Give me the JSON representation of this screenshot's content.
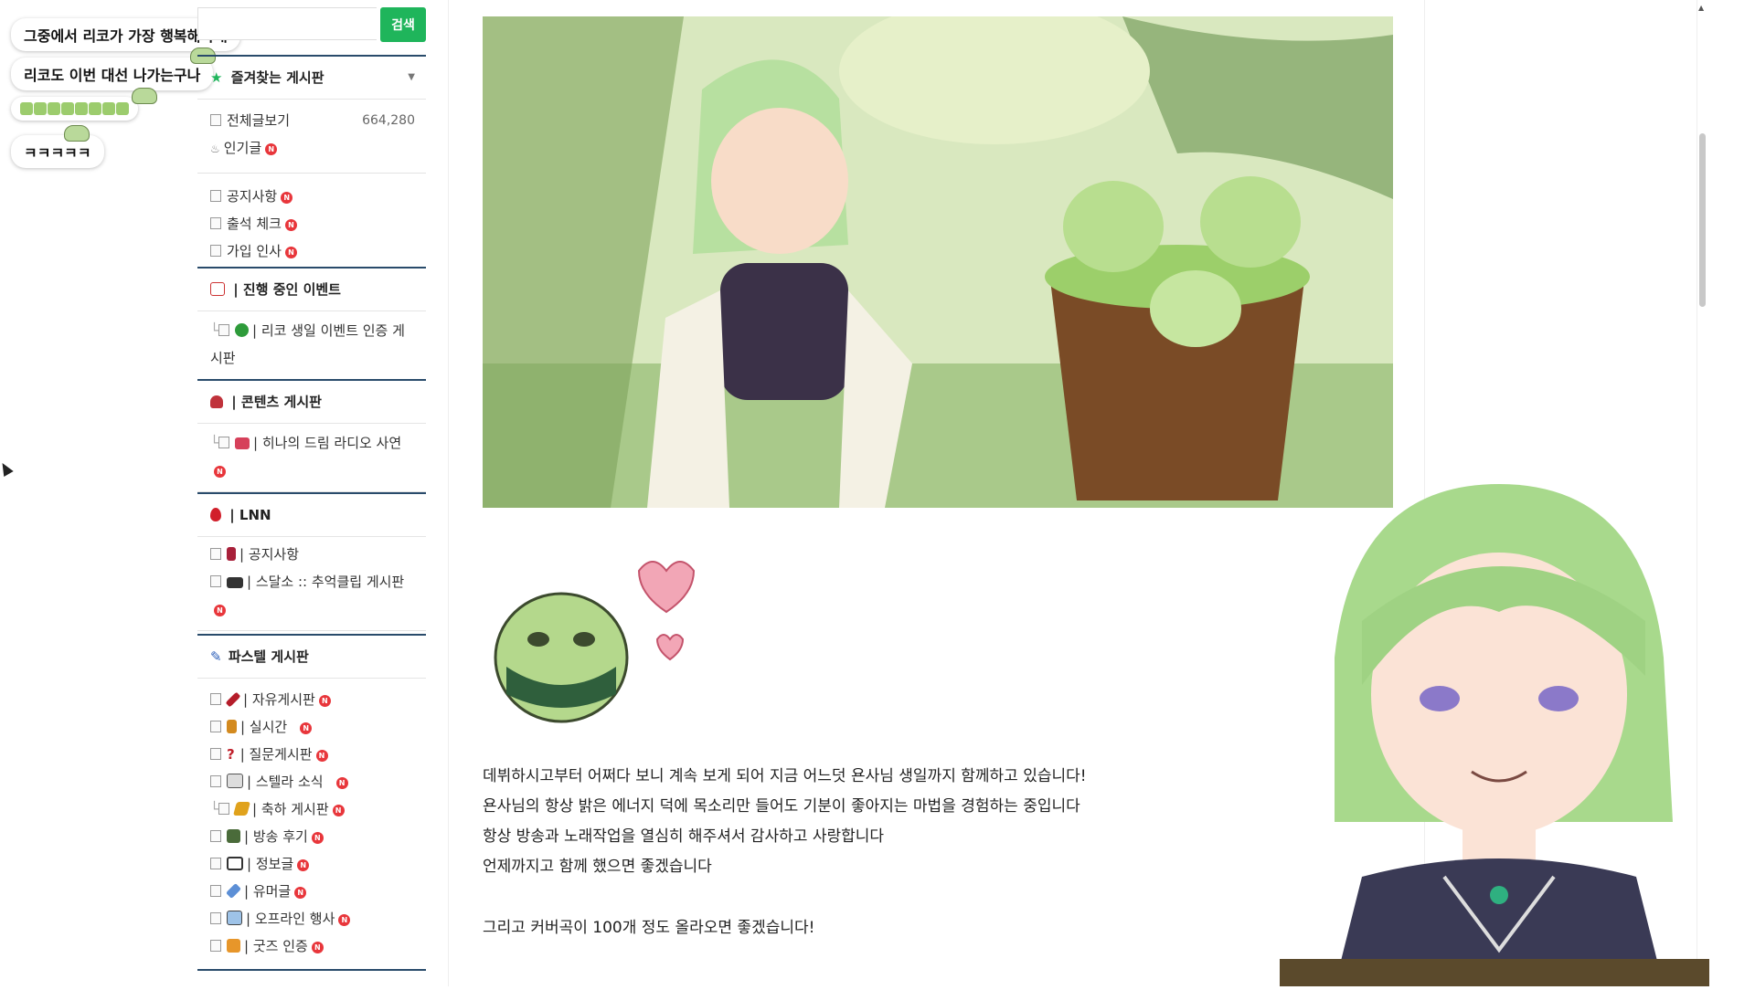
{
  "chat": {
    "messages": [
      "그중에서 리코가 가장 행복해야대",
      "리코도 이번 대선 나가는구나",
      "",
      "ㅋㅋㅋㅋㅋ"
    ]
  },
  "search": {
    "placeholder": "",
    "button_label": "검색",
    "accent": "#1fb55b"
  },
  "sidebar": {
    "favorites_title": "즐겨찾는 게시판",
    "all_posts_label": "전체글보기",
    "all_posts_count": "664,280",
    "popular_label": "인기글",
    "notice_label": "공지사항",
    "attendance_label": "출석 체크",
    "join_label": "가입 인사",
    "events_title": "| 진행 중인 이벤트",
    "event_item": "| 리코 생일 이벤트 인증 게시판",
    "contents_title": "| 콘텐츠 게시판",
    "contents_item": "| 히나의 드림 라디오 사연",
    "lnn_title": "| LNN",
    "lnn_notice": "| 공지사항",
    "lnn_clip": "| 스달소 :: 추억클립 게시판",
    "pastel_title": "파스텔 게시판",
    "pastel_items": [
      "| 자유게시판",
      "| 실시간",
      "| 질문게시판",
      "| 스텔라 소식",
      "| 축하 게시판",
      "| 방송 후기",
      "| 정보글",
      "| 유머글",
      "| 오프라인 행사",
      "| 굿즈 인증"
    ],
    "new_badge": "N"
  },
  "post": {
    "lines": [
      "데뷔하시고부터 어쩌다 보니 계속 보게 되어 지금 어느덧 욘사님 생일까지 함께하고 있습니다!",
      "욘사님의 항상 밝은 에너지 덕에 목소리만 들어도 기분이 좋아지는 마법을 경험하는 중입니다",
      "항상 방송과 노래작업을 열심히 해주셔서 감사하고 사랑합니다",
      "언제까지고 함께 했으면 좋겠습니다"
    ],
    "last_line": "그리고 커버곡이 100개 정도 올라오면 좋겠습니다!"
  }
}
